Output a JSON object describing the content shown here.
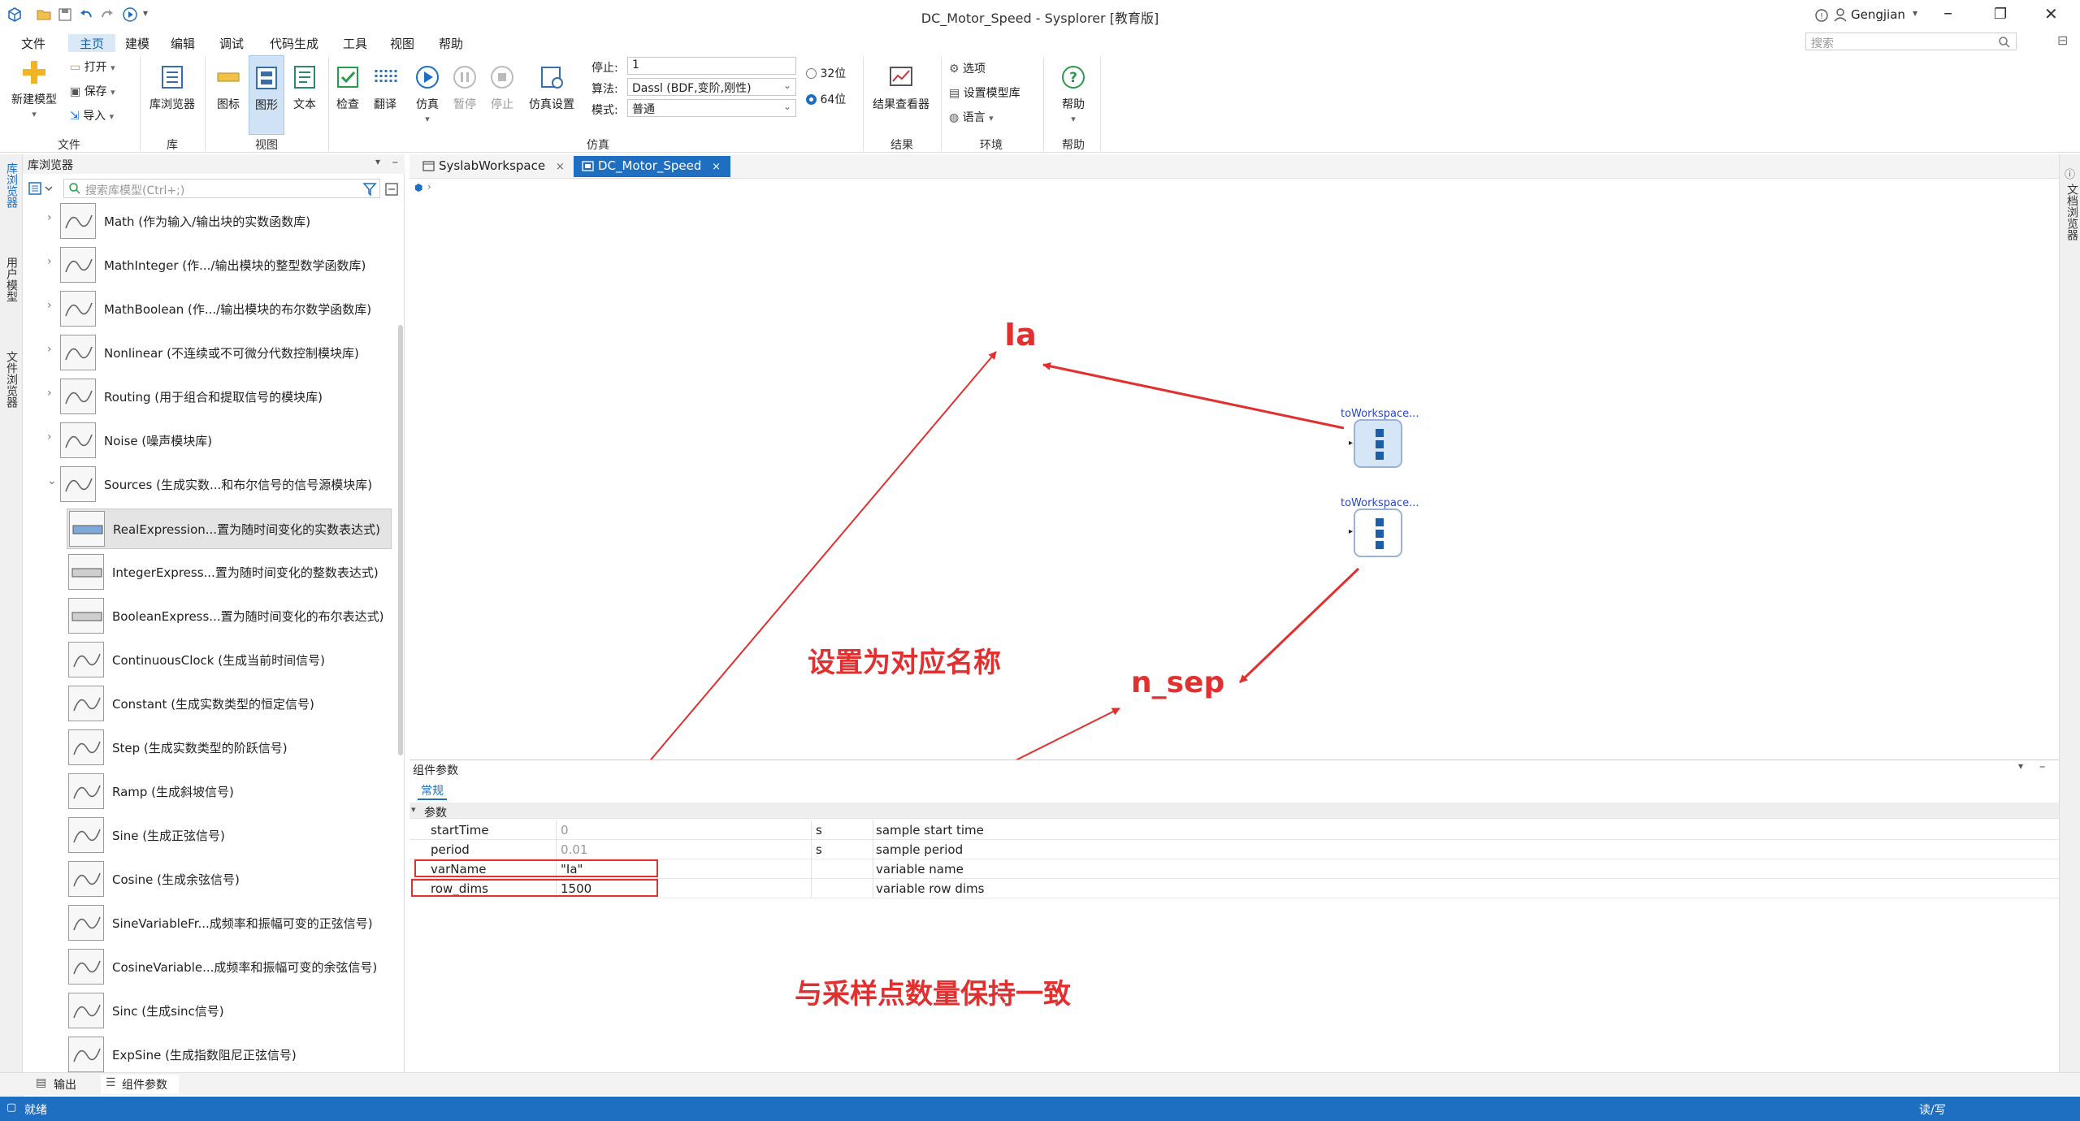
{
  "window": {
    "title": "DC_Motor_Speed - Sysplorer [教育版]",
    "user": "Gengjian",
    "search_placeholder": "搜索"
  },
  "menu": [
    "文件",
    "主页",
    "建模",
    "编辑",
    "调试",
    "代码生成",
    "工具",
    "视图",
    "帮助"
  ],
  "ribbon": {
    "new_model": "新建模型",
    "open": "打开",
    "save": "保存",
    "import": "导入",
    "file_group": "文件",
    "lib_browser": "库浏览器",
    "lib_group": "库",
    "icon": "图标",
    "graphic": "图形",
    "text": "文本",
    "view_group": "视图",
    "check": "检查",
    "translate": "翻译",
    "simulate": "仿真",
    "pause": "暂停",
    "stop": "停止",
    "sim_settings": "仿真设置",
    "stop_time_label": "停止:",
    "stop_time_value": "1",
    "algorithm_label": "算法:",
    "algorithm_value": "Dassl (BDF,变阶,刚性)",
    "mode_label": "模式:",
    "mode_value": "普通",
    "bit32": "32位",
    "bit64": "64位",
    "sim_group": "仿真",
    "result_viewer": "结果查看器",
    "result_group": "结果",
    "options": "选项",
    "set_model_lib": "设置模型库",
    "language": "语言",
    "env_group": "环境",
    "help": "帮助",
    "help_group": "帮助"
  },
  "left_strip": [
    "库浏览器",
    "用户模型",
    "文件浏览器"
  ],
  "library": {
    "header": "库浏览器",
    "search_placeholder": "搜索库模型(Ctrl+;)",
    "items": [
      {
        "label": "Math (作为输入/输出块的实数函数库)",
        "icon": "math-icon"
      },
      {
        "label": "MathInteger (作.../输出模块的整型数学函数库)",
        "icon": "math-integer-icon"
      },
      {
        "label": "MathBoolean (作.../输出模块的布尔数学函数库)",
        "icon": "math-boolean-icon"
      },
      {
        "label": "Nonlinear (不连续或不可微分代数控制模块库)",
        "icon": "nonlinear-icon"
      },
      {
        "label": "Routing (用于组合和提取信号的模块库)",
        "icon": "routing-icon"
      },
      {
        "label": "Noise (噪声模块库)",
        "icon": "noise-icon"
      },
      {
        "label": "Sources (生成实数...和布尔信号的信号源模块库)",
        "icon": "sources-icon"
      },
      {
        "label": "RealExpression...置为随时间变化的实数表达式)",
        "icon": "real-expression-icon"
      },
      {
        "label": "IntegerExpress...置为随时间变化的整数表达式)",
        "icon": "integer-expression-icon"
      },
      {
        "label": "BooleanExpress...置为随时间变化的布尔表达式)",
        "icon": "boolean-expression-icon"
      },
      {
        "label": "ContinuousClock (生成当前时间信号)",
        "icon": "clock-icon"
      },
      {
        "label": "Constant (生成实数类型的恒定信号)",
        "icon": "constant-icon"
      },
      {
        "label": "Step (生成实数类型的阶跃信号)",
        "icon": "step-icon"
      },
      {
        "label": "Ramp (生成斜坡信号)",
        "icon": "ramp-icon"
      },
      {
        "label": "Sine (生成正弦信号)",
        "icon": "sine-icon"
      },
      {
        "label": "Cosine (生成余弦信号)",
        "icon": "cosine-icon"
      },
      {
        "label": "SineVariableFr...成频率和振幅可变的正弦信号)",
        "icon": "sine-variable-icon"
      },
      {
        "label": "CosineVariable...成频率和振幅可变的余弦信号)",
        "icon": "cosine-variable-icon"
      },
      {
        "label": "Sinc (生成sinc信号)",
        "icon": "sinc-icon"
      },
      {
        "label": "ExpSine (生成指数阻尼正弦信号)",
        "icon": "expsine-icon"
      }
    ]
  },
  "tabs": [
    {
      "label": "SyslabWorkspace",
      "active": false
    },
    {
      "label": "DC_Motor_Speed",
      "active": true
    }
  ],
  "right_strip": "文档浏览器",
  "canvas": {
    "block1_label": "toWorkspace...",
    "block2_label": "toWorkspace...",
    "annotations": {
      "ia": "Ia",
      "n_sep": "n_sep",
      "set_name": "设置为对应名称",
      "keep_consistent": "与采样点数量保持一致"
    }
  },
  "params": {
    "title": "组件参数",
    "tab": "常规",
    "section": "参数",
    "rows": [
      {
        "name": "startTime",
        "value": "0",
        "unit": "s",
        "desc": "sample start time"
      },
      {
        "name": "period",
        "value": "0.01",
        "unit": "s",
        "desc": "sample period"
      },
      {
        "name": "varName",
        "value": "\"Ia\"",
        "unit": "",
        "desc": "variable name"
      },
      {
        "name": "row_dims",
        "value": "1500",
        "unit": "",
        "desc": "variable row dims"
      }
    ]
  },
  "bottom_tabs": [
    "输出",
    "组件参数"
  ],
  "status": {
    "left": "就绪",
    "right": "读/写"
  }
}
